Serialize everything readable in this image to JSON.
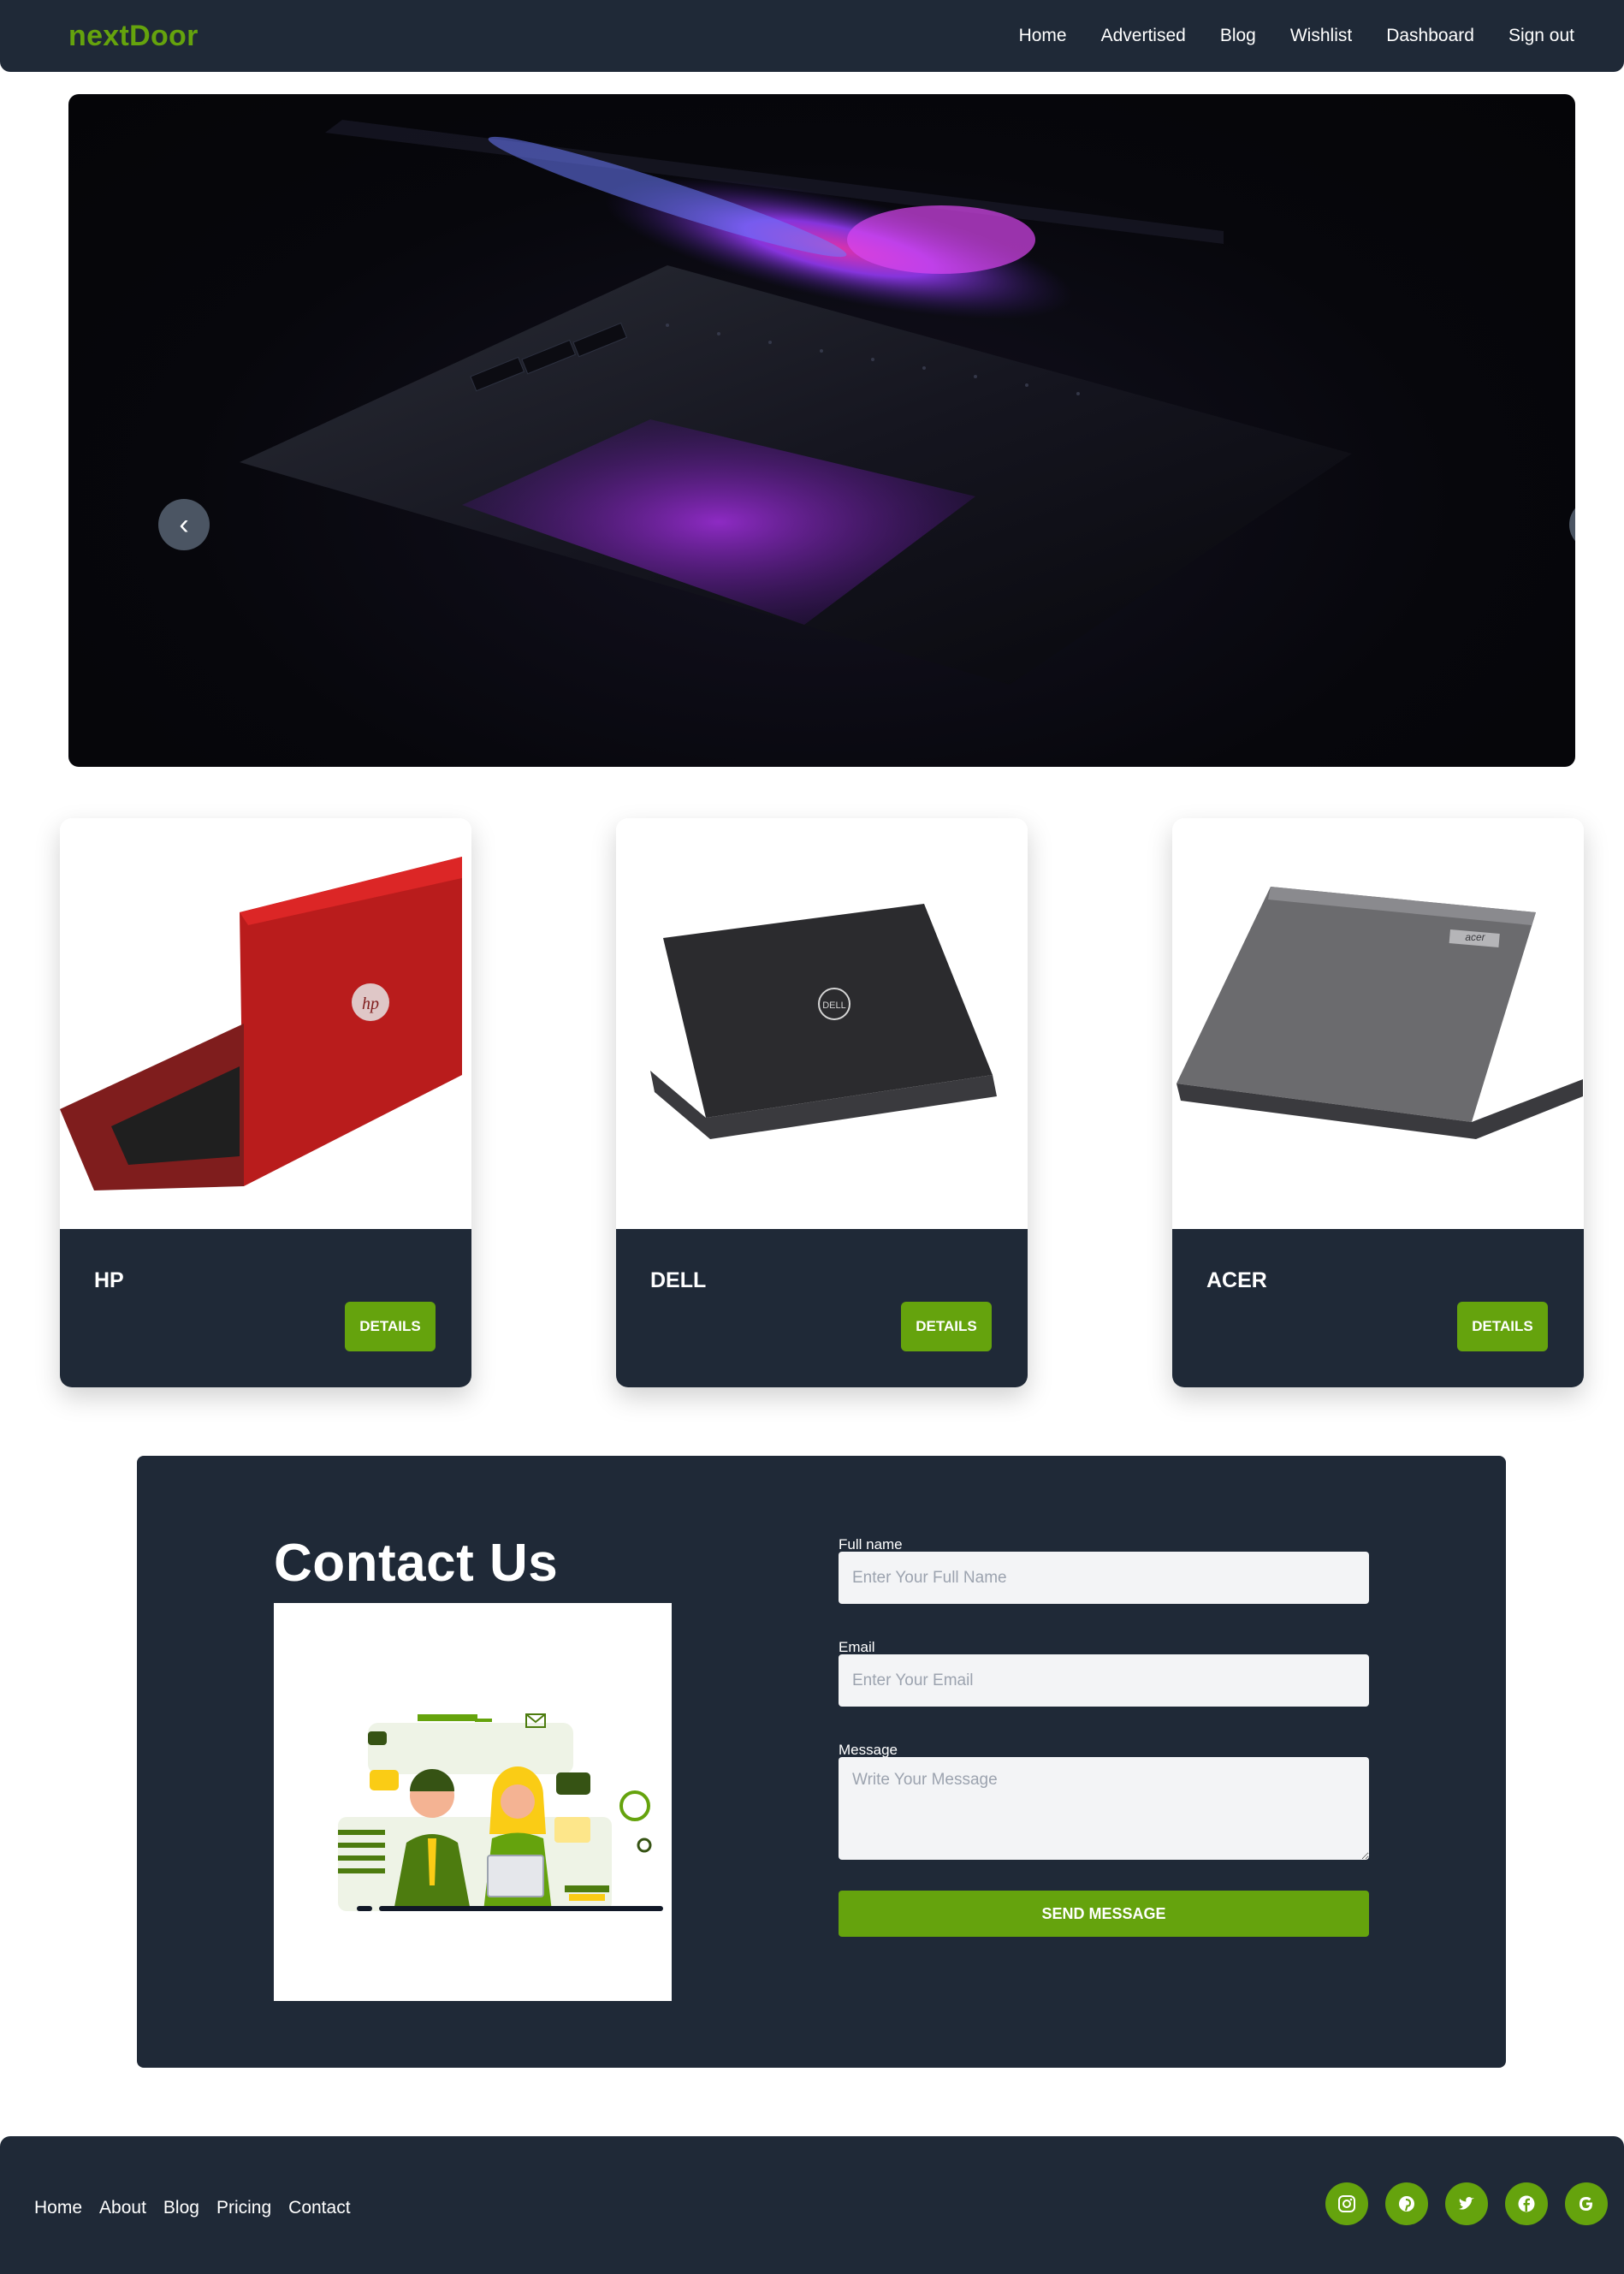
{
  "nav": {
    "brand": "nextDoor",
    "links": [
      "Home",
      "Advertised",
      "Blog",
      "Wishlist",
      "Dashboard",
      "Sign out"
    ]
  },
  "hero": {
    "prev_glyph": "‹",
    "next_glyph": "›",
    "image": "laptop-dark-keyboard-glow"
  },
  "cards": [
    {
      "title": "HP",
      "button": "DETAILS",
      "image": "red-hp-laptop",
      "color": "#b91c1c"
    },
    {
      "title": "DELL",
      "button": "DETAILS",
      "image": "black-dell-laptop",
      "color": "#2b2b2e"
    },
    {
      "title": "ACER",
      "button": "DETAILS",
      "image": "gray-acer-laptop",
      "color": "#6b6b6e"
    }
  ],
  "contact": {
    "title": "Contact Us",
    "illustration": "customer-support-illustration",
    "fields": {
      "name_label": "Full name",
      "name_placeholder": "Enter Your Full Name",
      "email_label": "Email",
      "email_placeholder": "Enter Your Email",
      "message_label": "Message",
      "message_placeholder": "Write Your Message"
    },
    "submit": "SEND MESSAGE"
  },
  "footer": {
    "links": [
      "Home",
      "About",
      "Blog",
      "Pricing",
      "Contact"
    ],
    "socials": [
      "instagram-icon",
      "pinterest-icon",
      "twitter-icon",
      "facebook-icon",
      "google-icon"
    ]
  },
  "colors": {
    "dark": "#1f2937",
    "accent": "#65a30d",
    "button_gray": "#4b5563",
    "input_bg": "#f3f4f6"
  }
}
